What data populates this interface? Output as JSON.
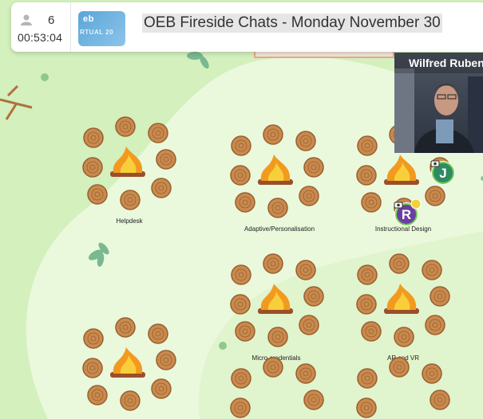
{
  "header": {
    "participant_count": "6",
    "timer": "00:53:04",
    "title": "OEB Fireside Chats - Monday November 30",
    "thumbnail_text_1": "eb",
    "thumbnail_text_2": "RTUAL 20"
  },
  "video": {
    "name": "Wilfred Ruben"
  },
  "rooms": [
    {
      "label": "Helpdesk"
    },
    {
      "label": "Adaptive/Personalisation"
    },
    {
      "label": "Instructional Design"
    },
    {
      "label": "Micro-credentials"
    },
    {
      "label": "AR and VR"
    }
  ],
  "avatars": [
    {
      "initial": "J",
      "color": "#2f8a63"
    },
    {
      "initial": "R",
      "color": "#6b3fa0"
    }
  ],
  "colors": {
    "grass": "#d3f0bd",
    "path": "#eaf8dc",
    "log": "#c98a4e",
    "fire": "#f29a1f"
  }
}
